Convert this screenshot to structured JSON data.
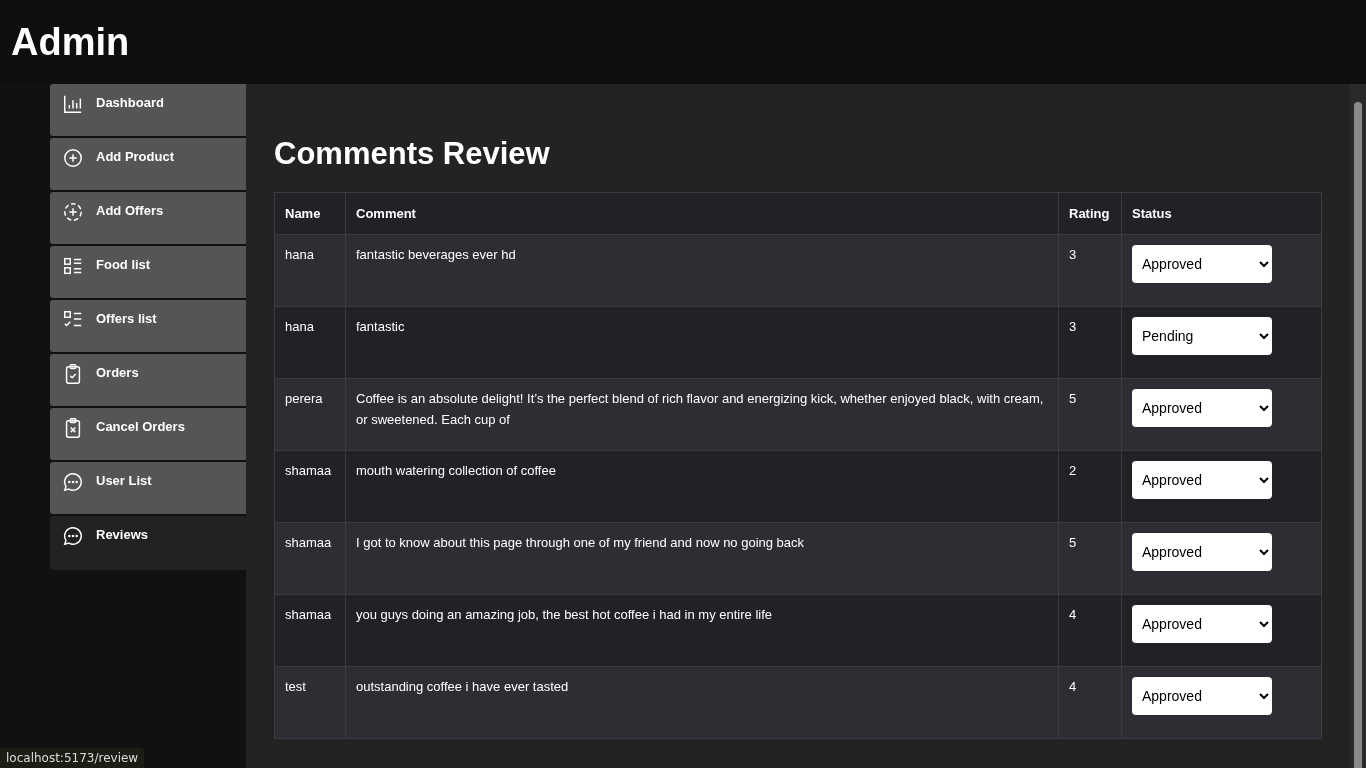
{
  "header": {
    "title": "Admin"
  },
  "sidebar": {
    "items": [
      {
        "label": "Dashboard",
        "selected": false
      },
      {
        "label": "Add Product",
        "selected": false
      },
      {
        "label": "Add Offers",
        "selected": false
      },
      {
        "label": "Food list",
        "selected": false
      },
      {
        "label": "Offers list",
        "selected": false
      },
      {
        "label": "Orders",
        "selected": false
      },
      {
        "label": "Cancel Orders",
        "selected": false
      },
      {
        "label": "User List",
        "selected": false
      },
      {
        "label": "Reviews",
        "selected": true
      }
    ]
  },
  "page": {
    "title": "Comments Review"
  },
  "table": {
    "columns": [
      "Name",
      "Comment",
      "Rating",
      "Status"
    ],
    "rows": [
      {
        "name": "hana",
        "comment": "fantastic beverages ever hd",
        "rating": "3",
        "status": "Approved"
      },
      {
        "name": "hana",
        "comment": "fantastic",
        "rating": "3",
        "status": "Pending"
      },
      {
        "name": "perera",
        "comment": "Coffee is an absolute delight! It’s the perfect blend of rich flavor and energizing kick, whether enjoyed black, with cream, or sweetened. Each cup of",
        "rating": "5",
        "status": "Approved"
      },
      {
        "name": "shamaa",
        "comment": "mouth watering collection of coffee",
        "rating": "2",
        "status": "Approved"
      },
      {
        "name": "shamaa",
        "comment": "I got to know about this page through one of my friend and now no going back",
        "rating": "5",
        "status": "Approved"
      },
      {
        "name": "shamaa",
        "comment": "you guys doing an amazing job, the best hot coffee i had in my entire life",
        "rating": "4",
        "status": "Approved"
      },
      {
        "name": "test",
        "comment": "outstanding coffee i have ever tasted",
        "rating": "4",
        "status": "Approved"
      }
    ]
  },
  "status_bar": {
    "url": "localhost:5173/review"
  }
}
